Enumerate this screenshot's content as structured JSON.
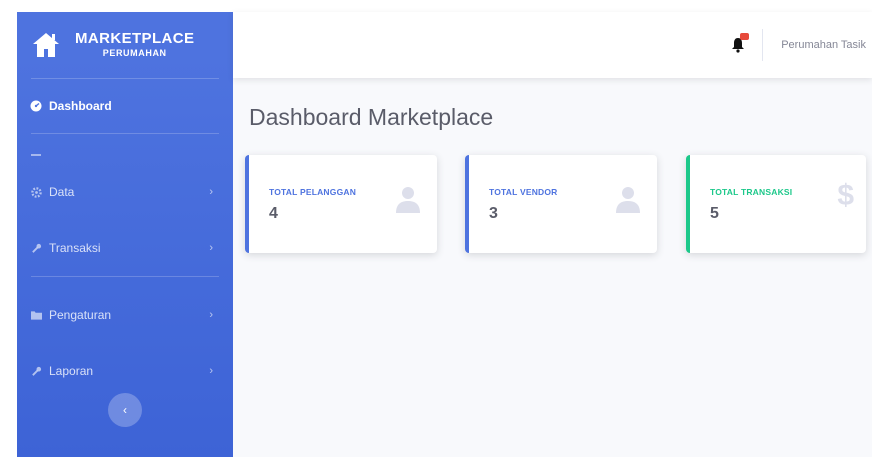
{
  "brand": {
    "title": "MARKETPLACE",
    "subtitle": "PERUMAHAN",
    "icon": "house-icon"
  },
  "sidebar": {
    "items": [
      {
        "label": "Dashboard",
        "icon": "tachometer-icon",
        "active": true
      },
      {
        "label": "Data",
        "icon": "gear-icon"
      },
      {
        "label": "Transaksi",
        "icon": "wrench-icon"
      },
      {
        "label": "Pengaturan",
        "icon": "folder-icon"
      },
      {
        "label": "Laporan",
        "icon": "wrench-icon"
      }
    ],
    "toggle_icon": "chevron-left-icon"
  },
  "topbar": {
    "user_name": "Perumahan Tasik",
    "bell_icon": "bell-icon"
  },
  "page": {
    "title": "Dashboard Marketplace"
  },
  "cards": [
    {
      "label": "TOTAL PELANGGAN",
      "value": "4",
      "icon": "user-icon",
      "color": "#4e73df"
    },
    {
      "label": "TOTAL VENDOR",
      "value": "3",
      "icon": "user-icon",
      "color": "#4e73df"
    },
    {
      "label": "TOTAL TRANSAKSI",
      "value": "5",
      "icon": "dollar-icon",
      "color": "#1cc88a"
    }
  ],
  "colors": {
    "primary": "#4e73df",
    "success": "#1cc88a",
    "danger": "#e74a3b"
  }
}
